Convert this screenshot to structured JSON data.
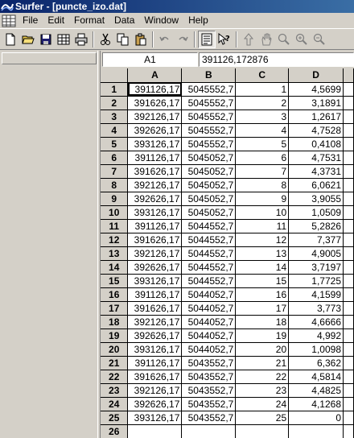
{
  "window": {
    "title": "Surfer - [puncte_izo.dat]"
  },
  "menu": [
    "File",
    "Edit",
    "Format",
    "Data",
    "Window",
    "Help"
  ],
  "toolbar": {
    "icons": [
      "new-file-icon",
      "open-folder-icon",
      "save-icon",
      "spreadsheet-icon",
      "print-icon",
      "cut-icon",
      "copy-icon",
      "paste-icon",
      "undo-icon",
      "redo-icon",
      "properties-icon",
      "help-pointer-icon",
      "select-arrow-icon",
      "pan-hand-icon",
      "zoom-icon",
      "zoom-in-icon",
      "zoom-out-icon"
    ]
  },
  "formula": {
    "cell_ref": "A1",
    "cell_value": "391126,172876"
  },
  "grid": {
    "columns": [
      "A",
      "B",
      "C",
      "D"
    ],
    "rows": [
      [
        "1",
        "391126,17",
        "5045552,7",
        "1",
        "4,5699"
      ],
      [
        "2",
        "391626,17",
        "5045552,7",
        "2",
        "3,1891"
      ],
      [
        "3",
        "392126,17",
        "5045552,7",
        "3",
        "1,2617"
      ],
      [
        "4",
        "392626,17",
        "5045552,7",
        "4",
        "4,7528"
      ],
      [
        "5",
        "393126,17",
        "5045552,7",
        "5",
        "0,4108"
      ],
      [
        "6",
        "391126,17",
        "5045052,7",
        "6",
        "4,7531"
      ],
      [
        "7",
        "391626,17",
        "5045052,7",
        "7",
        "4,3731"
      ],
      [
        "8",
        "392126,17",
        "5045052,7",
        "8",
        "6,0621"
      ],
      [
        "9",
        "392626,17",
        "5045052,7",
        "9",
        "3,9055"
      ],
      [
        "10",
        "393126,17",
        "5045052,7",
        "10",
        "1,0509"
      ],
      [
        "11",
        "391126,17",
        "5044552,7",
        "11",
        "5,2826"
      ],
      [
        "12",
        "391626,17",
        "5044552,7",
        "12",
        "7,377"
      ],
      [
        "13",
        "392126,17",
        "5044552,7",
        "13",
        "4,9005"
      ],
      [
        "14",
        "392626,17",
        "5044552,7",
        "14",
        "3,7197"
      ],
      [
        "15",
        "393126,17",
        "5044552,7",
        "15",
        "1,7725"
      ],
      [
        "16",
        "391126,17",
        "5044052,7",
        "16",
        "4,1599"
      ],
      [
        "17",
        "391626,17",
        "5044052,7",
        "17",
        "3,773"
      ],
      [
        "18",
        "392126,17",
        "5044052,7",
        "18",
        "4,6666"
      ],
      [
        "19",
        "392626,17",
        "5044052,7",
        "19",
        "4,992"
      ],
      [
        "20",
        "393126,17",
        "5044052,7",
        "20",
        "1,0098"
      ],
      [
        "21",
        "391126,17",
        "5043552,7",
        "21",
        "6,362"
      ],
      [
        "22",
        "391626,17",
        "5043552,7",
        "22",
        "4,5814"
      ],
      [
        "23",
        "392126,17",
        "5043552,7",
        "23",
        "4,4825"
      ],
      [
        "24",
        "392626,17",
        "5043552,7",
        "24",
        "4,1268"
      ],
      [
        "25",
        "393126,17",
        "5043552,7",
        "25",
        "0"
      ],
      [
        "26",
        "",
        "",
        "",
        ""
      ]
    ]
  }
}
